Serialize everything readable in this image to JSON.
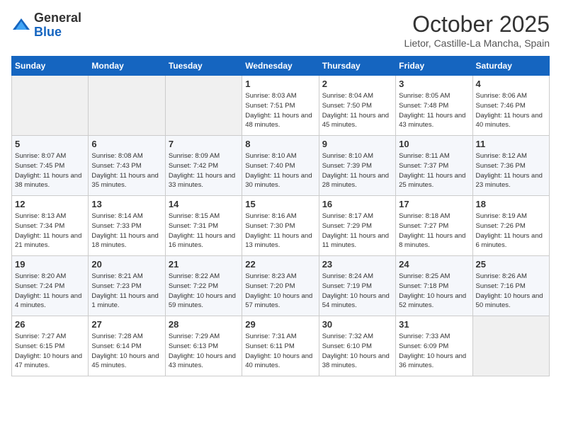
{
  "header": {
    "logo_line1": "General",
    "logo_line2": "Blue",
    "month": "October 2025",
    "location": "Lietor, Castille-La Mancha, Spain"
  },
  "days_of_week": [
    "Sunday",
    "Monday",
    "Tuesday",
    "Wednesday",
    "Thursday",
    "Friday",
    "Saturday"
  ],
  "weeks": [
    [
      {
        "day": "",
        "info": ""
      },
      {
        "day": "",
        "info": ""
      },
      {
        "day": "",
        "info": ""
      },
      {
        "day": "1",
        "info": "Sunrise: 8:03 AM\nSunset: 7:51 PM\nDaylight: 11 hours and 48 minutes."
      },
      {
        "day": "2",
        "info": "Sunrise: 8:04 AM\nSunset: 7:50 PM\nDaylight: 11 hours and 45 minutes."
      },
      {
        "day": "3",
        "info": "Sunrise: 8:05 AM\nSunset: 7:48 PM\nDaylight: 11 hours and 43 minutes."
      },
      {
        "day": "4",
        "info": "Sunrise: 8:06 AM\nSunset: 7:46 PM\nDaylight: 11 hours and 40 minutes."
      }
    ],
    [
      {
        "day": "5",
        "info": "Sunrise: 8:07 AM\nSunset: 7:45 PM\nDaylight: 11 hours and 38 minutes."
      },
      {
        "day": "6",
        "info": "Sunrise: 8:08 AM\nSunset: 7:43 PM\nDaylight: 11 hours and 35 minutes."
      },
      {
        "day": "7",
        "info": "Sunrise: 8:09 AM\nSunset: 7:42 PM\nDaylight: 11 hours and 33 minutes."
      },
      {
        "day": "8",
        "info": "Sunrise: 8:10 AM\nSunset: 7:40 PM\nDaylight: 11 hours and 30 minutes."
      },
      {
        "day": "9",
        "info": "Sunrise: 8:10 AM\nSunset: 7:39 PM\nDaylight: 11 hours and 28 minutes."
      },
      {
        "day": "10",
        "info": "Sunrise: 8:11 AM\nSunset: 7:37 PM\nDaylight: 11 hours and 25 minutes."
      },
      {
        "day": "11",
        "info": "Sunrise: 8:12 AM\nSunset: 7:36 PM\nDaylight: 11 hours and 23 minutes."
      }
    ],
    [
      {
        "day": "12",
        "info": "Sunrise: 8:13 AM\nSunset: 7:34 PM\nDaylight: 11 hours and 21 minutes."
      },
      {
        "day": "13",
        "info": "Sunrise: 8:14 AM\nSunset: 7:33 PM\nDaylight: 11 hours and 18 minutes."
      },
      {
        "day": "14",
        "info": "Sunrise: 8:15 AM\nSunset: 7:31 PM\nDaylight: 11 hours and 16 minutes."
      },
      {
        "day": "15",
        "info": "Sunrise: 8:16 AM\nSunset: 7:30 PM\nDaylight: 11 hours and 13 minutes."
      },
      {
        "day": "16",
        "info": "Sunrise: 8:17 AM\nSunset: 7:29 PM\nDaylight: 11 hours and 11 minutes."
      },
      {
        "day": "17",
        "info": "Sunrise: 8:18 AM\nSunset: 7:27 PM\nDaylight: 11 hours and 8 minutes."
      },
      {
        "day": "18",
        "info": "Sunrise: 8:19 AM\nSunset: 7:26 PM\nDaylight: 11 hours and 6 minutes."
      }
    ],
    [
      {
        "day": "19",
        "info": "Sunrise: 8:20 AM\nSunset: 7:24 PM\nDaylight: 11 hours and 4 minutes."
      },
      {
        "day": "20",
        "info": "Sunrise: 8:21 AM\nSunset: 7:23 PM\nDaylight: 11 hours and 1 minute."
      },
      {
        "day": "21",
        "info": "Sunrise: 8:22 AM\nSunset: 7:22 PM\nDaylight: 10 hours and 59 minutes."
      },
      {
        "day": "22",
        "info": "Sunrise: 8:23 AM\nSunset: 7:20 PM\nDaylight: 10 hours and 57 minutes."
      },
      {
        "day": "23",
        "info": "Sunrise: 8:24 AM\nSunset: 7:19 PM\nDaylight: 10 hours and 54 minutes."
      },
      {
        "day": "24",
        "info": "Sunrise: 8:25 AM\nSunset: 7:18 PM\nDaylight: 10 hours and 52 minutes."
      },
      {
        "day": "25",
        "info": "Sunrise: 8:26 AM\nSunset: 7:16 PM\nDaylight: 10 hours and 50 minutes."
      }
    ],
    [
      {
        "day": "26",
        "info": "Sunrise: 7:27 AM\nSunset: 6:15 PM\nDaylight: 10 hours and 47 minutes."
      },
      {
        "day": "27",
        "info": "Sunrise: 7:28 AM\nSunset: 6:14 PM\nDaylight: 10 hours and 45 minutes."
      },
      {
        "day": "28",
        "info": "Sunrise: 7:29 AM\nSunset: 6:13 PM\nDaylight: 10 hours and 43 minutes."
      },
      {
        "day": "29",
        "info": "Sunrise: 7:31 AM\nSunset: 6:11 PM\nDaylight: 10 hours and 40 minutes."
      },
      {
        "day": "30",
        "info": "Sunrise: 7:32 AM\nSunset: 6:10 PM\nDaylight: 10 hours and 38 minutes."
      },
      {
        "day": "31",
        "info": "Sunrise: 7:33 AM\nSunset: 6:09 PM\nDaylight: 10 hours and 36 minutes."
      },
      {
        "day": "",
        "info": ""
      }
    ]
  ]
}
